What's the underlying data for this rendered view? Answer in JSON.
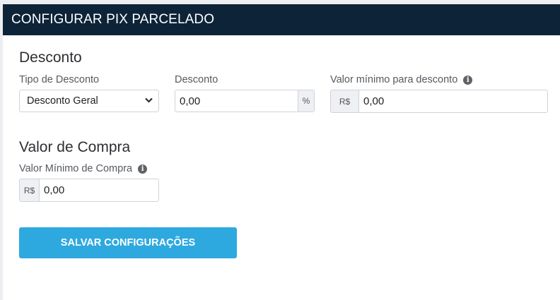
{
  "header": {
    "title": "CONFIGURAR PIX PARCELADO"
  },
  "discount_section": {
    "title": "Desconto",
    "type_label": "Tipo de Desconto",
    "type_selected": "Desconto Geral",
    "discount_label": "Desconto",
    "discount_value": "0,00",
    "discount_suffix": "%",
    "min_value_label": "Valor mínimo para desconto",
    "min_value_prefix": "R$",
    "min_value_value": "0,00"
  },
  "purchase_section": {
    "title": "Valor de Compra",
    "min_purchase_label": "Valor Mínimo de Compra",
    "min_purchase_prefix": "R$",
    "min_purchase_value": "0,00"
  },
  "actions": {
    "save_label": "SALVAR CONFIGURAÇÕES"
  },
  "icons": {
    "info": "info-icon",
    "dropdown": "chevron-down-icon"
  },
  "colors": {
    "header_bg": "#0d2338",
    "primary_button": "#2ea9df"
  }
}
